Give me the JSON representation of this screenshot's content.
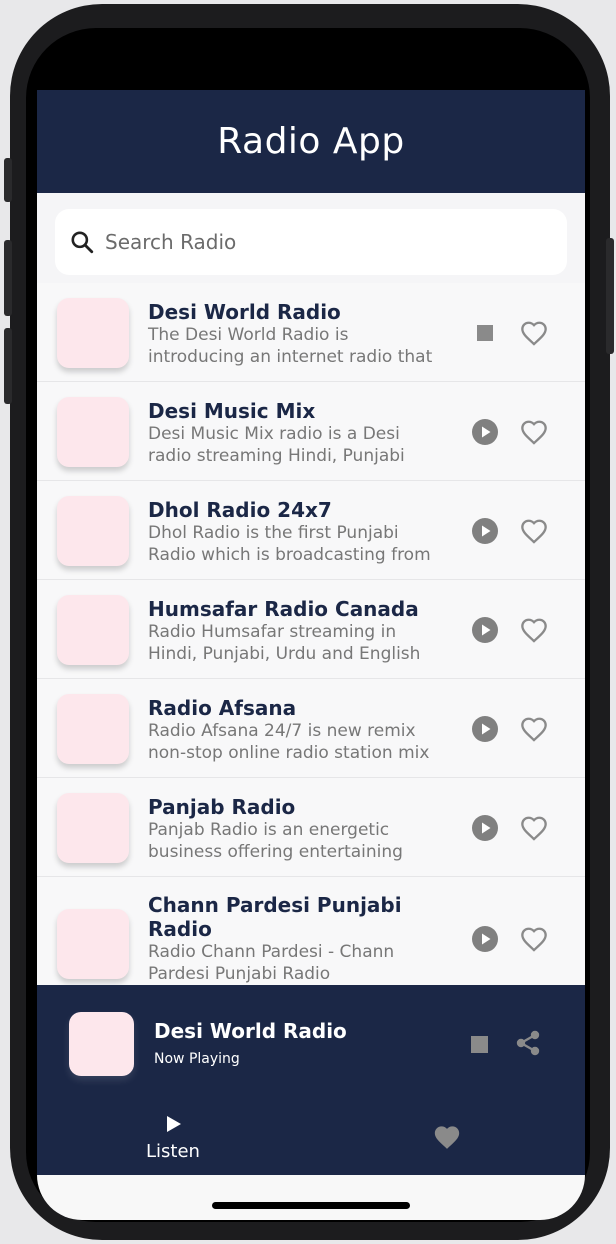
{
  "header": {
    "title": "Radio App"
  },
  "search": {
    "placeholder": "Search Radio"
  },
  "stations": [
    {
      "name": "Desi World Radio",
      "desc_line1": "The Desi World Radio is",
      "desc_line2": "introducing an internet radio that",
      "state": "playing"
    },
    {
      "name": "Desi Music Mix",
      "desc_line1": "Desi Music Mix radio is a Desi",
      "desc_line2": "radio streaming Hindi, Punjabi",
      "state": "stopped"
    },
    {
      "name": "Dhol Radio 24x7",
      "desc_line1": "Dhol Radio is the first Punjabi",
      "desc_line2": "Radio which is broadcasting from",
      "state": "stopped"
    },
    {
      "name": "Humsafar Radio Canada",
      "desc_line1": "Radio Humsafar streaming in",
      "desc_line2": "Hindi, Punjabi, Urdu and English",
      "state": "stopped"
    },
    {
      "name": "Radio Afsana",
      "desc_line1": "Radio Afsana 24/7 is new remix",
      "desc_line2": "non-stop online radio station mix",
      "state": "stopped"
    },
    {
      "name": "Panjab Radio",
      "desc_line1": "Panjab Radio is an energetic",
      "desc_line2": "business offering entertaining",
      "state": "stopped"
    },
    {
      "name_line1": "Chann Pardesi Punjabi",
      "name_line2": "Radio",
      "desc_line1": "Radio Chann Pardesi - Chann",
      "desc_line2": "Pardesi Punjabi Radio",
      "state": "stopped"
    }
  ],
  "now_playing": {
    "title": "Desi World Radio",
    "subtitle": "Now Playing"
  },
  "tabs": {
    "listen_label": "Listen"
  },
  "icons": {
    "search": "search-icon",
    "stop": "stop-icon",
    "play": "play-circle-icon",
    "favorite": "heart-outline-icon",
    "share": "share-icon",
    "tab_favorites": "heart-filled-icon"
  },
  "colors": {
    "header_bg": "#1b2746",
    "thumb": "#fde7ec",
    "icon_gray": "#808080"
  }
}
